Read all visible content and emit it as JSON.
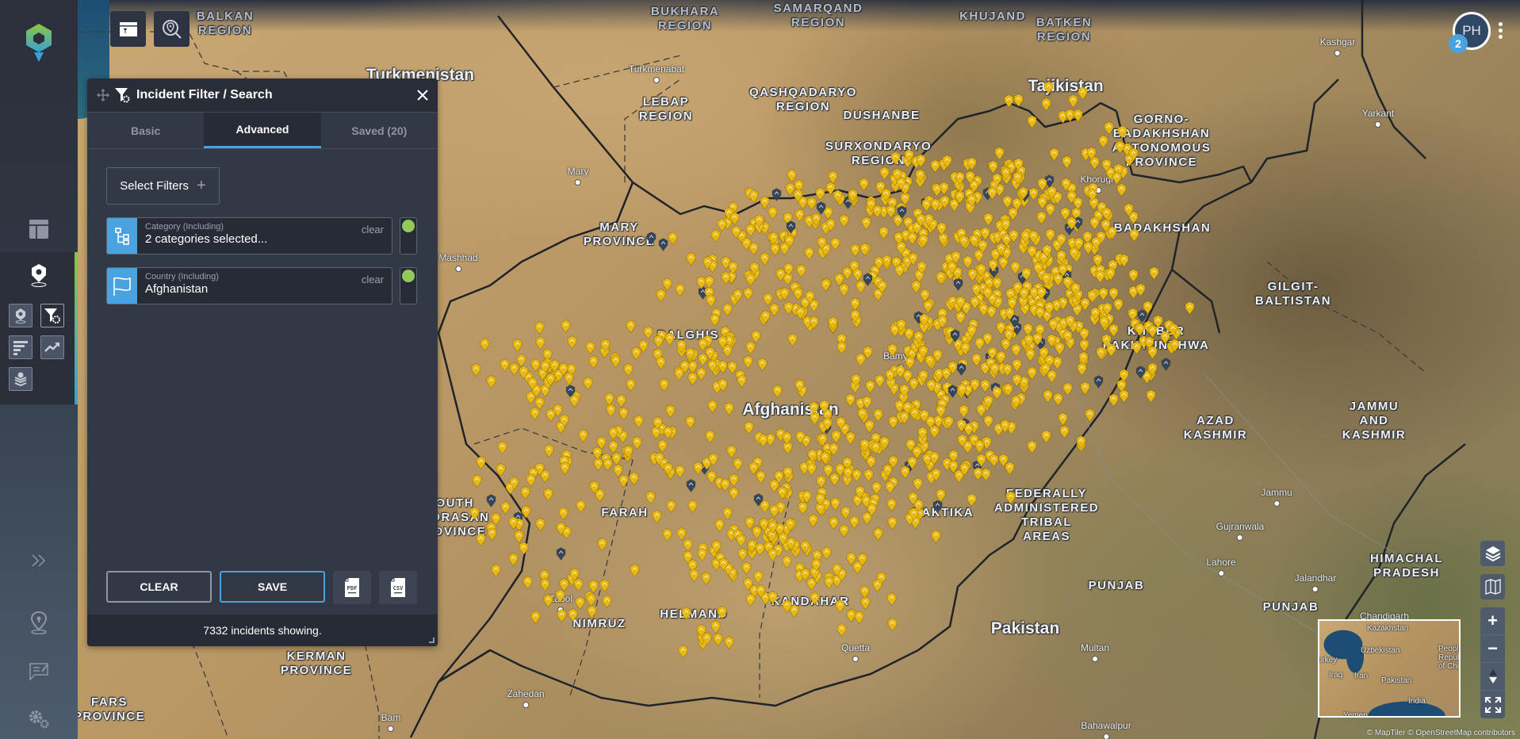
{
  "app": {
    "logo": "app-logo"
  },
  "rail": {
    "items": [
      {
        "name": "dashboard",
        "icon": "layout-icon"
      },
      {
        "name": "incidents-map",
        "icon": "map-pin-icon"
      },
      {
        "name": "expand",
        "icon": "chevron-double-right-icon"
      },
      {
        "name": "location",
        "icon": "location-pin-icon"
      },
      {
        "name": "reports",
        "icon": "note-edit-icon"
      },
      {
        "name": "settings",
        "icon": "gears-icon"
      }
    ],
    "sub_tools": [
      {
        "name": "incident-pin",
        "icon": "pin-icon",
        "active": false
      },
      {
        "name": "filter-settings",
        "icon": "filter-gear-icon",
        "active": true
      },
      {
        "name": "bar-chart",
        "icon": "bars-icon",
        "active": false
      },
      {
        "name": "trend",
        "icon": "trend-up-icon",
        "active": false
      },
      {
        "name": "layers-pin",
        "icon": "layers-pin-icon",
        "active": false
      }
    ]
  },
  "panel": {
    "title": "Incident Filter / Search",
    "tabs": [
      {
        "label": "Basic",
        "active": false
      },
      {
        "label": "Advanced",
        "active": true
      },
      {
        "label": "Saved (20)",
        "active": false
      }
    ],
    "select_filters_label": "Select Filters",
    "filters": [
      {
        "label": "Category (Including)",
        "value": "2 categories selected...",
        "clear_label": "clear",
        "enabled": true,
        "icon": "hierarchy-icon"
      },
      {
        "label": "Country (Including)",
        "value": "Afghanistan",
        "clear_label": "clear",
        "enabled": true,
        "icon": "flag-icon"
      }
    ],
    "clear_label": "CLEAR",
    "save_label": "SAVE",
    "export_pdf": "PDF",
    "export_csv": "CSV",
    "status": "7332 incidents showing."
  },
  "user": {
    "initials": "PH",
    "notifications": "2"
  },
  "map": {
    "labels": [
      {
        "text": "BALKAN\nREGION",
        "kind": "region"
      },
      {
        "text": "Turkmenistan",
        "kind": "country"
      },
      {
        "text": "BUKHARA\nREGION",
        "kind": "region"
      },
      {
        "text": "SAMARQAND\nREGION",
        "kind": "region"
      },
      {
        "text": "KHUJAND",
        "kind": "region"
      },
      {
        "text": "BATKEN\nREGION",
        "kind": "region"
      },
      {
        "text": "LEBAP\nREGION",
        "kind": "region"
      },
      {
        "text": "QASHQADARYO\nREGION",
        "kind": "region"
      },
      {
        "text": "Tajikistan",
        "kind": "country"
      },
      {
        "text": "DUSHANBE",
        "kind": "region"
      },
      {
        "text": "GORNO-\nBADAKHSHAN\nAUTONOMOUS\nPROVINCE",
        "kind": "region"
      },
      {
        "text": "SURXONDARYO\nREGION",
        "kind": "region"
      },
      {
        "text": "MARY\nPROVINCE",
        "kind": "region"
      },
      {
        "text": "BADAKHSHAN",
        "kind": "region"
      },
      {
        "text": "GILGIT-\nBALTISTAN",
        "kind": "region"
      },
      {
        "text": "KHYBER\nPAKHTUNKHWA",
        "kind": "region"
      },
      {
        "text": "BALGHIS",
        "kind": "region"
      },
      {
        "text": "Afghanistan",
        "kind": "country"
      },
      {
        "text": "AZAD\nKASHMIR",
        "kind": "region"
      },
      {
        "text": "JAMMU\nAND\nKASHMIR",
        "kind": "region"
      },
      {
        "text": "FEDERALLY\nADMINISTERED\nTRIBAL\nAREAS",
        "kind": "region"
      },
      {
        "text": "PAKTIKA",
        "kind": "region"
      },
      {
        "text": "SOUTH\nKHORASAN\nPROVINCE",
        "kind": "region"
      },
      {
        "text": "FARAH",
        "kind": "region"
      },
      {
        "text": "HIMACHAL\nPRADESH",
        "kind": "region"
      },
      {
        "text": "PUNJAB",
        "kind": "region"
      },
      {
        "text": "PUNJAB",
        "kind": "region"
      },
      {
        "text": "NIMRUZ",
        "kind": "region"
      },
      {
        "text": "HELMAND",
        "kind": "region"
      },
      {
        "text": "KANDAHAR",
        "kind": "region"
      },
      {
        "text": "Pakistan",
        "kind": "country"
      },
      {
        "text": "KERMAN\nPROVINCE",
        "kind": "region"
      },
      {
        "text": "FARS\nPROVINCE",
        "kind": "region"
      }
    ],
    "cities": [
      "Turkmenabat",
      "Mary",
      "Mashhad",
      "Kashgar",
      "Yarkant",
      "Khorugh",
      "Bamyan",
      "Jammu",
      "Gujranwala",
      "Lahore",
      "Jalandhar",
      "Chandigarh",
      "Multan",
      "Bahawalpur",
      "Quetta",
      "Zabol",
      "Zahedan",
      "Bam"
    ],
    "minimap_labels": [
      "Kazakhstan",
      "Uzbekistan",
      "Turkey",
      "Iraq",
      "Iran",
      "Pakistan",
      "India",
      "People's Republic of China",
      "Yemen"
    ],
    "attribution": "© MapTiler © OpenStreetMap contributors",
    "pin_colors": {
      "primary": "#e8b80f",
      "secondary": "#34455c"
    }
  }
}
